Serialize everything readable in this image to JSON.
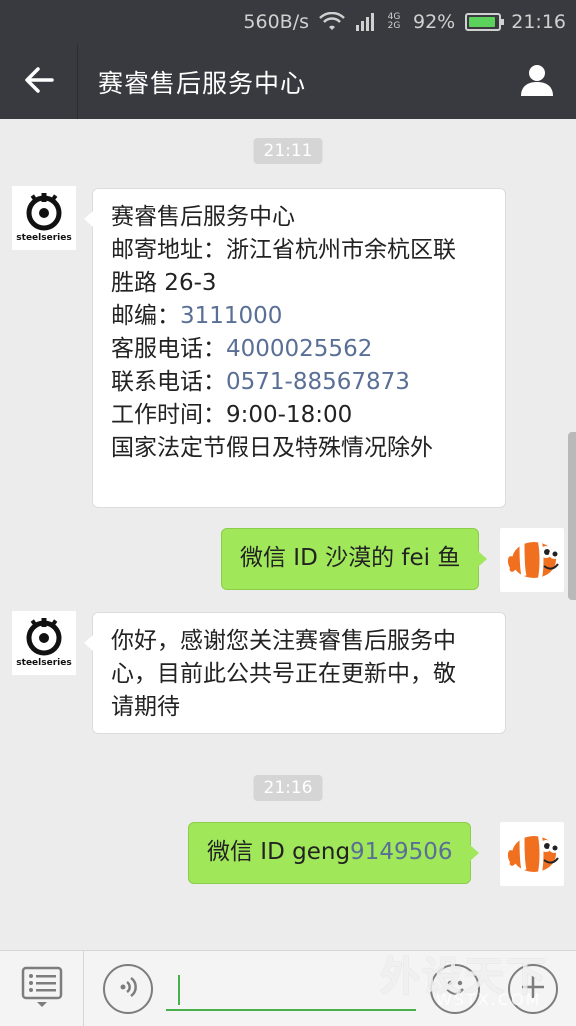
{
  "status_bar": {
    "net_speed": "560B/s",
    "network": "4G 2G",
    "battery": "92%",
    "battery_level": 0.92,
    "time": "21:16"
  },
  "header": {
    "title": "赛睿售后服务中心"
  },
  "messages": [
    {
      "type": "timestamp",
      "text": "21:11"
    },
    {
      "type": "incoming",
      "sender_avatar": "steelseries-logo",
      "avatar_text": "steelseries",
      "lines": [
        {
          "label": "赛睿售后服务中心",
          "value": ""
        },
        {
          "label": "邮寄地址：浙江省杭州市余杭区联",
          "value": ""
        },
        {
          "label": "胜路 26-3",
          "value": ""
        },
        {
          "label": "邮编：",
          "value": "3111000"
        },
        {
          "label": "客服电话：",
          "value": "4000025562"
        },
        {
          "label": "联系电话：",
          "value": "0571-88567873"
        },
        {
          "label": "工作时间：9:00-18:00",
          "value": ""
        },
        {
          "label": "国家法定节假日及特殊情况除外",
          "value": ""
        }
      ]
    },
    {
      "type": "outgoing",
      "sender_avatar": "clownfish-avatar",
      "text": "微信 ID  沙漠的 fei 鱼"
    },
    {
      "type": "incoming",
      "sender_avatar": "steelseries-logo",
      "avatar_text": "steelseries",
      "lines": [
        {
          "label": "你好，感谢您关注赛睿售后服务中",
          "value": ""
        },
        {
          "label": "心，目前此公共号正在更新中，敬",
          "value": ""
        },
        {
          "label": "请期待",
          "value": ""
        }
      ]
    },
    {
      "type": "timestamp",
      "text": "21:16"
    },
    {
      "type": "outgoing",
      "sender_avatar": "clownfish-avatar",
      "text_prefix": "微信 ID  geng",
      "text_link": "9149506"
    }
  ],
  "input_bar": {
    "text_value": "",
    "watermark": "外设天下",
    "watermark_url": "WSTX.COM"
  },
  "icons": {
    "back": "back-arrow-icon",
    "profile": "person-icon",
    "menu": "menu-list-icon",
    "voice": "voice-icon",
    "emoji": "emoji-icon",
    "add": "plus-icon"
  },
  "colors": {
    "header_bg": "#393a3f",
    "chat_bg": "#ececec",
    "outgoing_bubble": "#a0e75a",
    "link": "#5a6f96",
    "input_accent": "#47b04b"
  }
}
